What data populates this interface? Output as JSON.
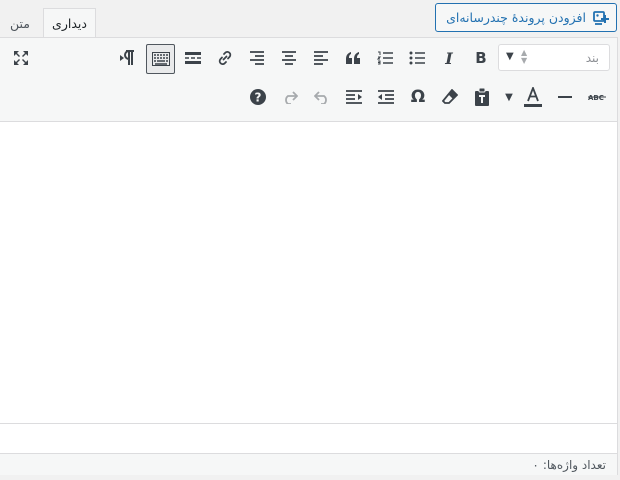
{
  "add_media": {
    "label": "افزودن پروندهٔ چندرسانه‌ای",
    "icon": "add-media-icon"
  },
  "tabs": [
    {
      "label": "دیداری",
      "active": true
    },
    {
      "label": "متن",
      "active": false
    }
  ],
  "format_select": {
    "value": "بند"
  },
  "word_count": {
    "label": "تعداد واژه‌ها:",
    "value": "۰"
  },
  "colors": {
    "accent": "#2271b1",
    "toolbar_bg": "#f6f7f7",
    "border": "#dcdcde",
    "icon": "#3c434a"
  }
}
